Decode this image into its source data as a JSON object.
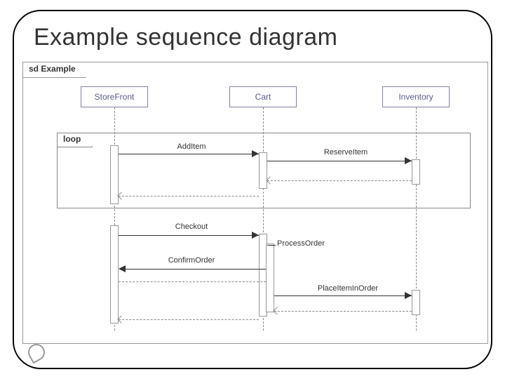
{
  "title": "Example sequence diagram",
  "frame_label": "sd Example",
  "lifelines": {
    "storefront": "StoreFront",
    "cart": "Cart",
    "inventory": "Inventory"
  },
  "loop_label": "loop",
  "messages": {
    "add_item": "AddItem",
    "reserve_item": "ReserveItem",
    "checkout": "Checkout",
    "confirm_order": "ConfirmOrder",
    "process_order": "ProcessOrder",
    "place_item_in_order": "PlaceItemInOrder"
  }
}
